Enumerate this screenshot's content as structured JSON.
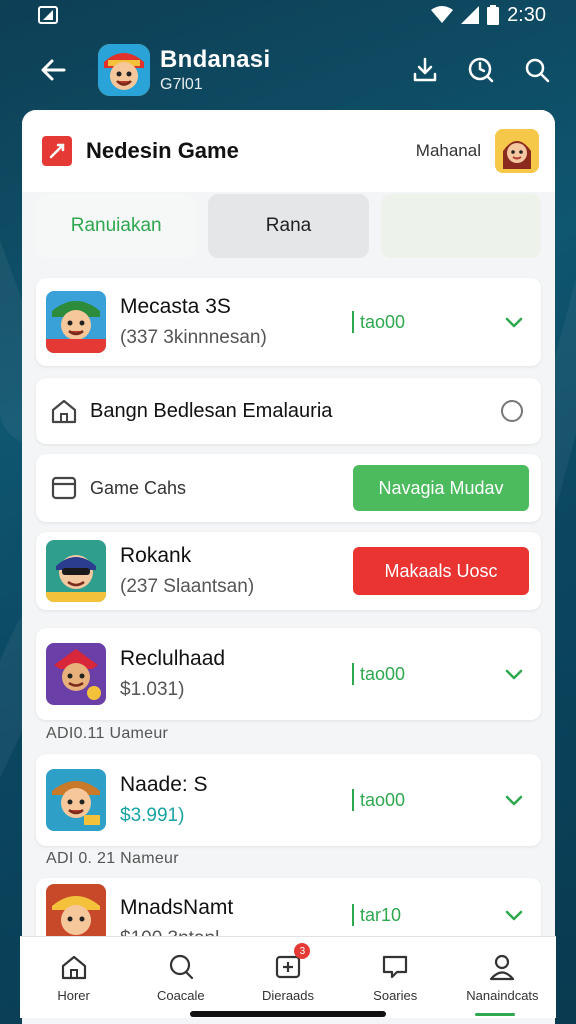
{
  "status_bar": {
    "time": "2:30"
  },
  "app_bar": {
    "title": "Bndanasi",
    "subtitle": "G7l01"
  },
  "game_header": {
    "title": "Nedesin Game",
    "right_label": "Mahanal"
  },
  "segments": [
    {
      "label": "Ranuiakan"
    },
    {
      "label": "Rana"
    },
    {
      "label": ""
    }
  ],
  "rows": {
    "game1": {
      "title": "Mecasta 3S",
      "sub": "(337 3kinnnesan)",
      "status": "tao00"
    },
    "house": {
      "label": "Bangn Bedlesan Emalauria"
    },
    "game_cats": {
      "label": "Game Cahs",
      "button": "Navagia Mudav"
    },
    "game2": {
      "title": "Rokank",
      "sub": "(237 Slaantsan)",
      "button": "Makaals Uosc"
    },
    "game3": {
      "title": "Reclulhaad",
      "sub": "$1.031)",
      "status": "tao00"
    },
    "section1": "ADI0.11  Uameur",
    "game4": {
      "title": "Naade: S",
      "sub": "$3.991)",
      "status": "tao00"
    },
    "section2": "ADI 0. 21  Nameur",
    "game5": {
      "title": "MnadsNamt",
      "sub": "$100.3ntanl",
      "status": "tar10"
    }
  },
  "bottom_nav": [
    {
      "label": "Horer",
      "icon": "home-icon"
    },
    {
      "label": "Coacale",
      "icon": "search-icon"
    },
    {
      "label": "Dieraads",
      "icon": "downloads-icon",
      "badge": "3"
    },
    {
      "label": "Soaries",
      "icon": "chat-icon"
    },
    {
      "label": "Nanaindcats",
      "icon": "profile-icon"
    }
  ],
  "colors": {
    "accent": "#2ea84f",
    "danger": "#e93431",
    "teal": "#1aa3a3",
    "background": "#0d3f55"
  }
}
